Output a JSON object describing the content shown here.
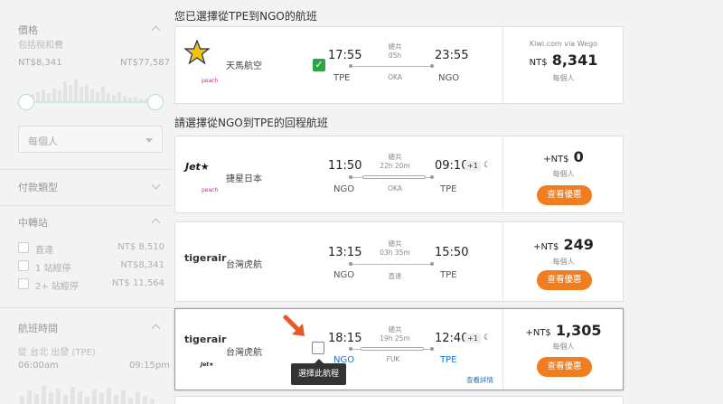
{
  "sidebar": {
    "price": {
      "title": "價格",
      "subtitle": "包括稅和費",
      "min": "NT$8,341",
      "max": "NT$77,587"
    },
    "per_person_select": {
      "value": "每個人"
    },
    "payment_type": {
      "title": "付款類型"
    },
    "stops": {
      "title": "中轉站",
      "options": [
        {
          "label": "直達",
          "price": "NT$ 8,510"
        },
        {
          "label": "1 站經停",
          "price": "NT$8,341"
        },
        {
          "label": "2+ 站經停",
          "price": "NT$ 11,564"
        }
      ]
    },
    "flight_time": {
      "title": "航班時間",
      "subtitle": "從 台北 出發 (TPE)",
      "start": "06:00am",
      "end": "09:15pm"
    }
  },
  "outbound": {
    "title": "您已選擇從TPE到NGO的航班",
    "flight": {
      "airline": "天馬航空",
      "airline_logo_sub": "peach",
      "depart_time": "17:55",
      "depart_airport": "TPE",
      "arrive_time": "23:55",
      "arrive_airport": "NGO",
      "duration_label": "總共",
      "duration": "05h",
      "stop": "OKA",
      "source": "Kiwi.com via Wego",
      "currency": "NT$",
      "price": "8,341",
      "per_person": "每個人"
    }
  },
  "return": {
    "title": "請選擇從NGO到TPE的回程航班",
    "flights": [
      {
        "airline": "捷星日本",
        "logo_main": "Jet★",
        "logo_sub": "peach",
        "depart_time": "11:50",
        "depart_airport": "NGO",
        "arrive_time": "09:10",
        "arrive_airport": "TPE",
        "plus_day": "+1",
        "duration_label": "總共",
        "duration": "22h 20m",
        "stop": "OKA",
        "currency_prefix": "+NT$",
        "price": "0",
        "per_person": "每個人",
        "button": "查看優惠"
      },
      {
        "airline": "台灣虎航",
        "logo_main": "tigerair",
        "depart_time": "13:15",
        "depart_airport": "NGO",
        "arrive_time": "15:50",
        "arrive_airport": "TPE",
        "duration_label": "總共",
        "duration": "03h 35m",
        "stop": "直達",
        "currency_prefix": "+NT$",
        "price": "249",
        "per_person": "每個人",
        "button": "查看優惠"
      },
      {
        "airline": "台灣虎航",
        "logo_main": "tigerair",
        "logo_sub": "Jet★",
        "depart_time": "18:15",
        "depart_airport": "NGO",
        "arrive_time": "12:40",
        "arrive_airport": "TPE",
        "plus_day": "+1",
        "duration_label": "總共",
        "duration": "19h 25m",
        "stop": "FUK",
        "currency_prefix": "+NT$",
        "price": "1,305",
        "per_person": "每個人",
        "button": "查看優惠",
        "details_link": "查看詳情"
      }
    ],
    "tooltip": "選擇此航程"
  },
  "colors": {
    "accent_orange": "#f07d1f",
    "check_green": "#2aa744",
    "link_blue": "#1a73c9"
  }
}
